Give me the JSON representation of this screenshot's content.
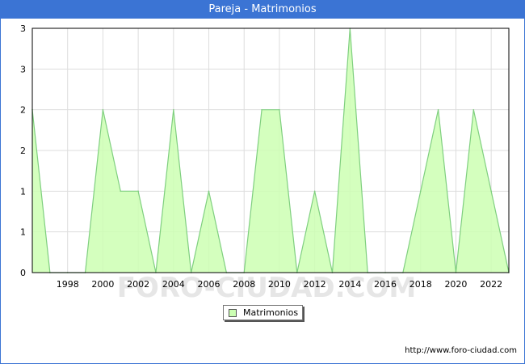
{
  "title": "Pareja - Matrimonios",
  "source_url": "http://www.foro-ciudad.com",
  "watermark": "FORO-CIUDAD.COM",
  "chart_data": {
    "type": "area",
    "title": "Pareja - Matrimonios",
    "x": [
      1996,
      1997,
      1998,
      1999,
      2000,
      2001,
      2002,
      2003,
      2004,
      2005,
      2006,
      2007,
      2008,
      2009,
      2010,
      2011,
      2012,
      2013,
      2014,
      2015,
      2016,
      2017,
      2018,
      2019,
      2020,
      2021,
      2022,
      2023
    ],
    "series": [
      {
        "name": "Matrimonios",
        "values": [
          2,
          0,
          0,
          0,
          2,
          1,
          1,
          0,
          2,
          0,
          1,
          0,
          0,
          2,
          2,
          0,
          1,
          0,
          3,
          0,
          0,
          0,
          1,
          2,
          0,
          2,
          1,
          0
        ]
      }
    ],
    "x_ticks": [
      "1998",
      "2000",
      "2002",
      "2004",
      "2006",
      "2008",
      "2010",
      "2012",
      "2014",
      "2016",
      "2018",
      "2020",
      "2022"
    ],
    "y_tick_labels": [
      "0",
      "1",
      "1",
      "2",
      "2",
      "3",
      "3"
    ],
    "ylim": [
      0,
      3
    ],
    "grid": true,
    "legend_position": "bottom",
    "colors": {
      "fill": "#ccffb3",
      "line": "#7fcf7f",
      "header": "#3b74d4"
    }
  }
}
